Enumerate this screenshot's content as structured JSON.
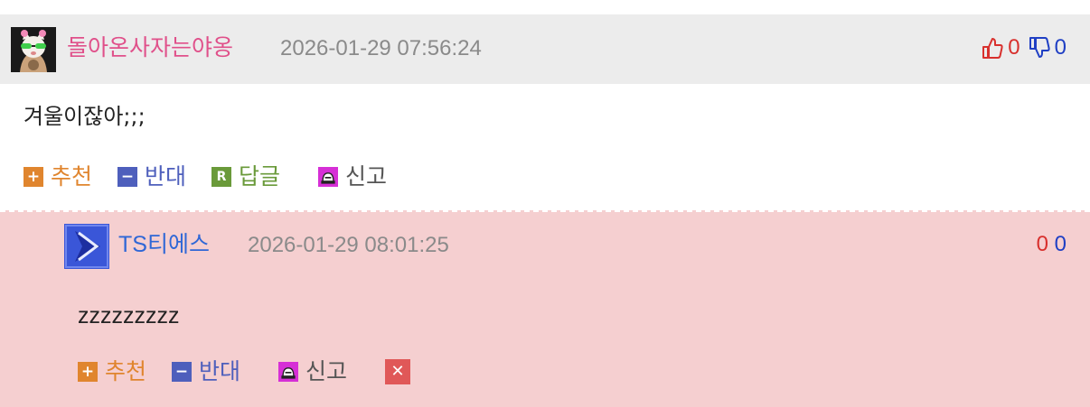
{
  "comment": {
    "author": "돌아온사자는야옹",
    "datetime": "2026-01-29 07:56:24",
    "upvotes": "0",
    "downvotes": "0",
    "body": "겨울이잖아;;;",
    "actions": {
      "recommend": "추천",
      "oppose": "반대",
      "reply": "답글",
      "report": "신고"
    }
  },
  "reply": {
    "author_latin": "TS",
    "author_korean": "티에스",
    "datetime": "2026-01-29 08:01:25",
    "upvotes": "0",
    "downvotes": "0",
    "body": "zzzzzzzzz",
    "actions": {
      "recommend": "추천",
      "oppose": "반대",
      "report": "신고"
    }
  },
  "colors": {
    "header_bg": "#ececec",
    "reply_bg": "#f5cfd0",
    "author_pink": "#e0508a",
    "author_blue": "#2f67d6",
    "recommend_orange": "#e0852e",
    "oppose_blue": "#4e5fbc",
    "reply_green": "#6a9a3a",
    "report_magenta": "#d62fd6",
    "delete_red": "#e05858",
    "upvote_red": "#d8302d",
    "downvote_blue": "#1f3fc4"
  },
  "icons": {
    "comment_avatar": "cat-with-sunglasses-avatar",
    "reply_avatar": "play-arrow-avatar",
    "upvote": "thumbs-up-icon",
    "downvote": "thumbs-down-icon",
    "recommend": "plus-icon",
    "oppose": "minus-icon",
    "reply": "r-reply-icon",
    "report": "siren-icon",
    "delete": "close-icon"
  }
}
